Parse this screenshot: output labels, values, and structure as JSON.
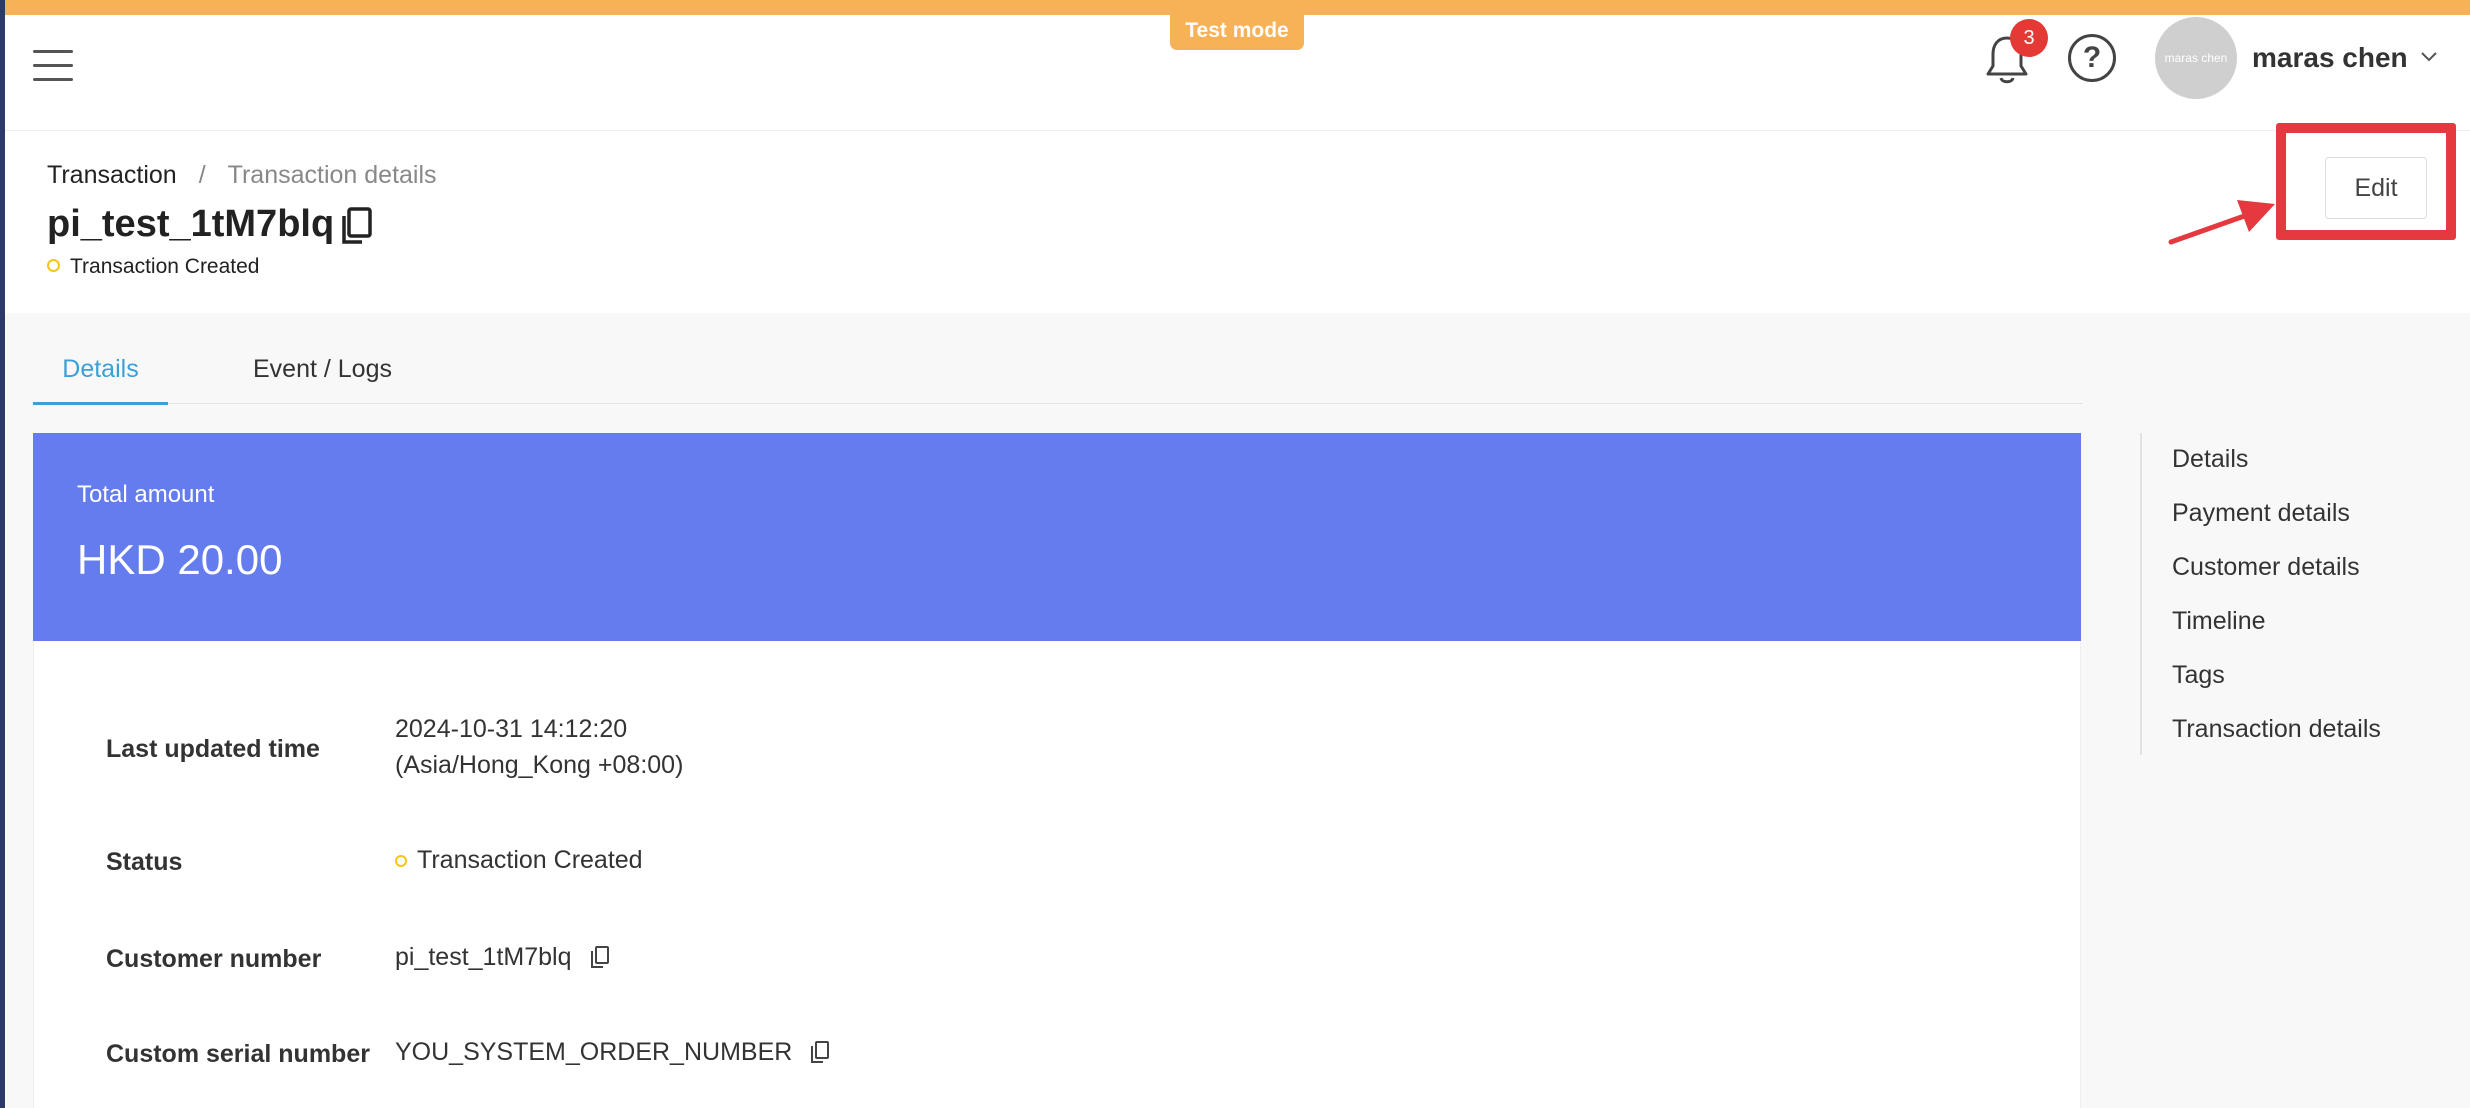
{
  "banner": {
    "test_mode": "Test mode"
  },
  "header": {
    "notifications_count": "3",
    "help_symbol": "?",
    "avatar_text": "maras chen",
    "user_name": "maras chen",
    "icons": [
      "menu-icon",
      "bell-icon",
      "help-icon",
      "chevron-down-icon"
    ]
  },
  "breadcrumb": {
    "parent": "Transaction",
    "separator": "/",
    "current": "Transaction details"
  },
  "page": {
    "title": "pi_test_1tM7blq",
    "status": "Transaction Created",
    "edit_label": "Edit"
  },
  "tabs": [
    {
      "label": "Details",
      "active": true
    },
    {
      "label": "Event / Logs",
      "active": false
    }
  ],
  "summary": {
    "label": "Total amount",
    "amount": "HKD 20.00"
  },
  "details": {
    "last_updated_label": "Last updated time",
    "last_updated_value": "2024-10-31 14:12:20",
    "last_updated_tz": "(Asia/Hong_Kong +08:00)",
    "status_label": "Status",
    "status_value": "Transaction Created",
    "customer_number_label": "Customer number",
    "customer_number_value": "pi_test_1tM7blq",
    "serial_label": "Custom serial number",
    "serial_value": "YOU_SYSTEM_ORDER_NUMBER"
  },
  "anchor_nav": [
    "Details",
    "Payment details",
    "Customer details",
    "Timeline",
    "Tags",
    "Transaction details"
  ],
  "colors": {
    "accent_orange": "#f7b257",
    "summary_blue": "#647cee",
    "tab_active": "#3aa0d8",
    "badge_red": "#e53935",
    "highlight_red": "#e53940",
    "status_dot": "#f5c518"
  }
}
